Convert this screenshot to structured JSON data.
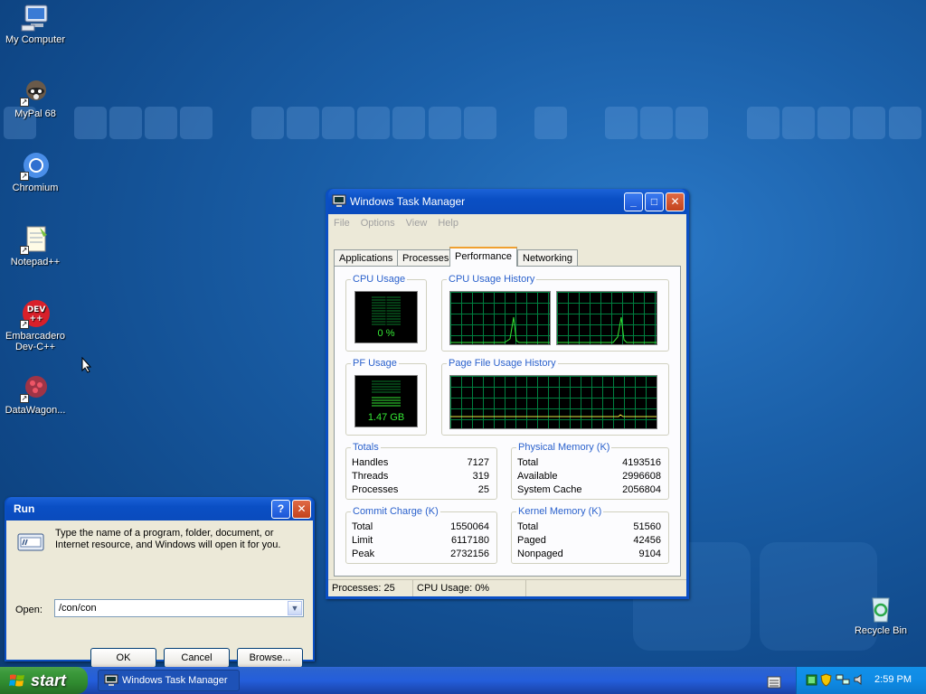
{
  "desktop": {
    "icons": [
      {
        "label": "My Computer"
      },
      {
        "label": "MyPal 68"
      },
      {
        "label": "Chromium"
      },
      {
        "label": "Notepad++"
      },
      {
        "label": "Embarcadero Dev-C++"
      },
      {
        "label": "DataWagon..."
      },
      {
        "label": "Recycle Bin"
      }
    ]
  },
  "taskmgr": {
    "title": "Windows Task Manager",
    "menu": [
      "File",
      "Options",
      "View",
      "Help"
    ],
    "tabs": [
      "Applications",
      "Processes",
      "Performance",
      "Networking"
    ],
    "active_tab": "Performance",
    "cpu_usage_label": "CPU Usage",
    "cpu_usage_value": "0 %",
    "cpu_history_label": "CPU Usage History",
    "pf_usage_label": "PF Usage",
    "pf_usage_value": "1.47 GB",
    "pf_history_label": "Page File Usage History",
    "totals": {
      "label": "Totals",
      "rows": [
        {
          "name": "Handles",
          "value": "7127"
        },
        {
          "name": "Threads",
          "value": "319"
        },
        {
          "name": "Processes",
          "value": "25"
        }
      ]
    },
    "physical_memory": {
      "label": "Physical Memory (K)",
      "rows": [
        {
          "name": "Total",
          "value": "4193516"
        },
        {
          "name": "Available",
          "value": "2996608"
        },
        {
          "name": "System Cache",
          "value": "2056804"
        }
      ]
    },
    "commit_charge": {
      "label": "Commit Charge (K)",
      "rows": [
        {
          "name": "Total",
          "value": "1550064"
        },
        {
          "name": "Limit",
          "value": "6117180"
        },
        {
          "name": "Peak",
          "value": "2732156"
        }
      ]
    },
    "kernel_memory": {
      "label": "Kernel Memory (K)",
      "rows": [
        {
          "name": "Total",
          "value": "51560"
        },
        {
          "name": "Paged",
          "value": "42456"
        },
        {
          "name": "Nonpaged",
          "value": "9104"
        }
      ]
    },
    "status": {
      "processes": "Processes: 25",
      "cpu": "CPU Usage: 0%"
    }
  },
  "run": {
    "title": "Run",
    "message": "Type the name of a program, folder, document, or Internet resource, and Windows will open it for you.",
    "open_label": "Open:",
    "open_value": "/con/con",
    "ok": "OK",
    "cancel": "Cancel",
    "browse": "Browse..."
  },
  "taskbar": {
    "start": "start",
    "task_button": "Windows Task Manager",
    "clock": "2:59 PM"
  },
  "colors": {
    "graph_line": "#35e835",
    "xp_blue": "#0a4fc4",
    "group_label": "#2a61cc"
  }
}
